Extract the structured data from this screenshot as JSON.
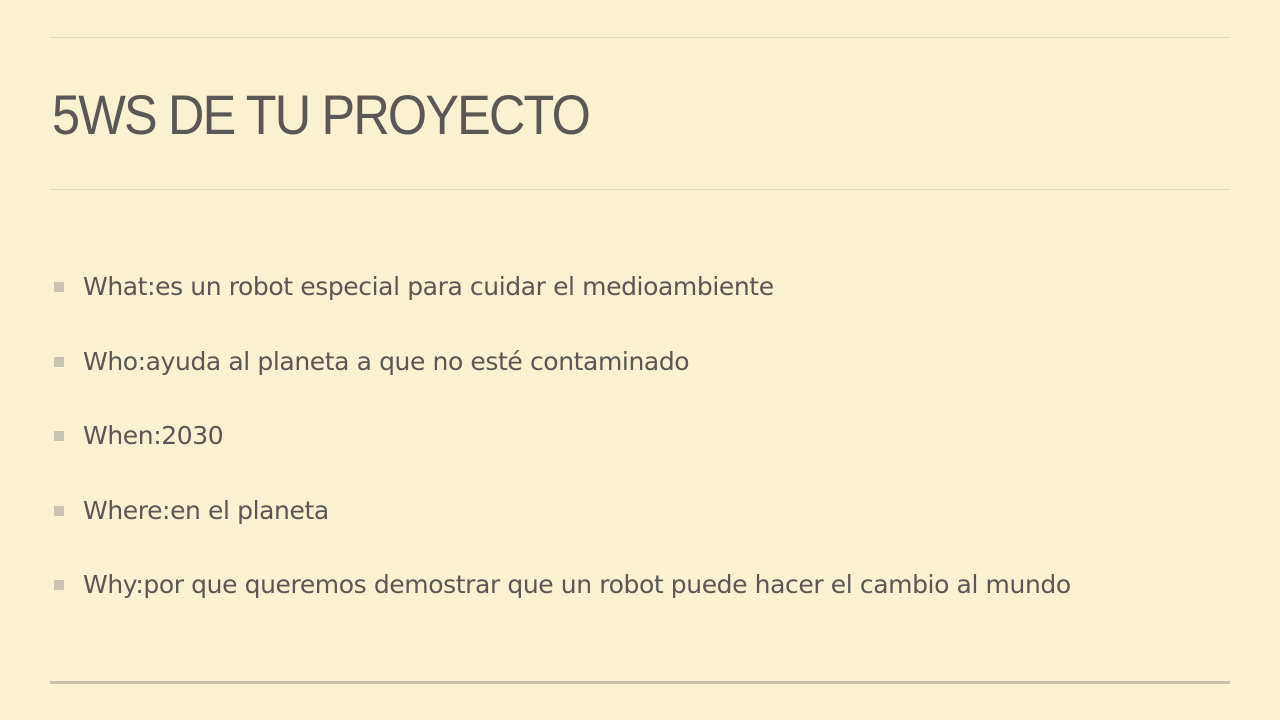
{
  "slide": {
    "title": "5WS DE TU PROYECTO",
    "bullets": [
      {
        "text": "What:es un robot especial para cuidar el medioambiente"
      },
      {
        "text": "Who:ayuda al planeta a que no esté contaminado"
      },
      {
        "text": "When:2030"
      },
      {
        "text": "Where:en el planeta"
      },
      {
        "text": "Why:por que queremos demostrar que un robot puede hacer el cambio al mundo"
      }
    ]
  },
  "colors": {
    "background": "#faf1d2",
    "text": "#5b5754",
    "rule": "#e3d9b9",
    "bullet_marker": "#c8c3b3"
  }
}
